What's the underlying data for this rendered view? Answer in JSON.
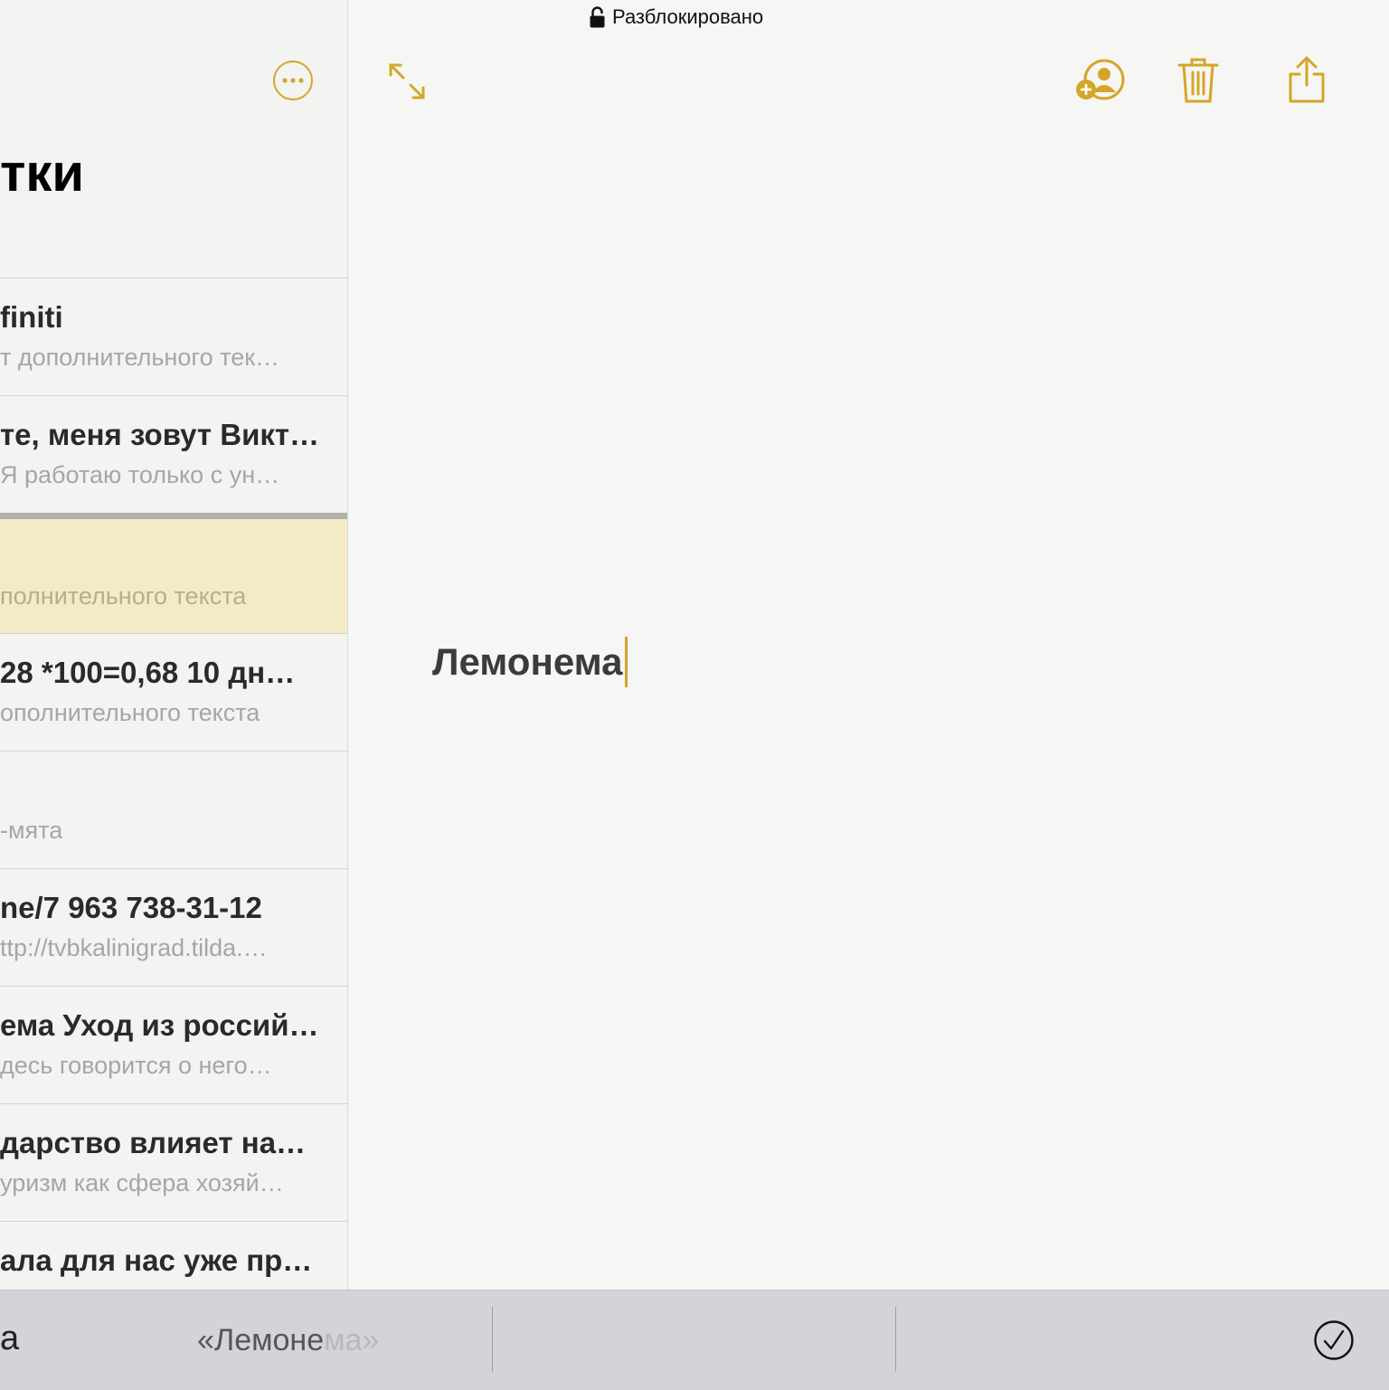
{
  "status_bar": {
    "lock_text": "Разблокировано"
  },
  "sidebar": {
    "title": "тки",
    "notes": [
      {
        "title": "finiti",
        "subtitle": "т дополнительного тек…"
      },
      {
        "title": "те, меня зовут Викт…",
        "subtitle": "Я работаю только с ун…"
      },
      {
        "title": "",
        "subtitle": "полнительного текста",
        "selected": true
      },
      {
        "title": "28 *100=0,68 10 дн…",
        "subtitle": "ополнительного текста"
      },
      {
        "title": "",
        "subtitle": "-мята"
      },
      {
        "title": "ne/7 963 738-31-12",
        "subtitle": "ttp://tvbkalinigrad.tilda.…"
      },
      {
        "title": "ема Уход из россий…",
        "subtitle": "десь говорится о него…"
      },
      {
        "title": "дарство влияет на…",
        "subtitle": "уризм как сфера хозяй…"
      },
      {
        "title": "ала для нас уже пр…",
        "subtitle": ""
      }
    ]
  },
  "toolbar": {
    "icons": [
      "more-icon",
      "expand-icon",
      "add-person-icon",
      "trash-icon",
      "share-icon"
    ]
  },
  "editor": {
    "text": "Лемонема"
  },
  "keyboard_suggestions": {
    "left": "а",
    "quoted_main": "«Лемоне",
    "quoted_fade": "ма»",
    "done_icon": "checkmark-circle-icon"
  },
  "colors": {
    "accent": "#d4a628",
    "selected_row": "#f5eac6",
    "keyboard_bar": "#d3d4d8"
  }
}
